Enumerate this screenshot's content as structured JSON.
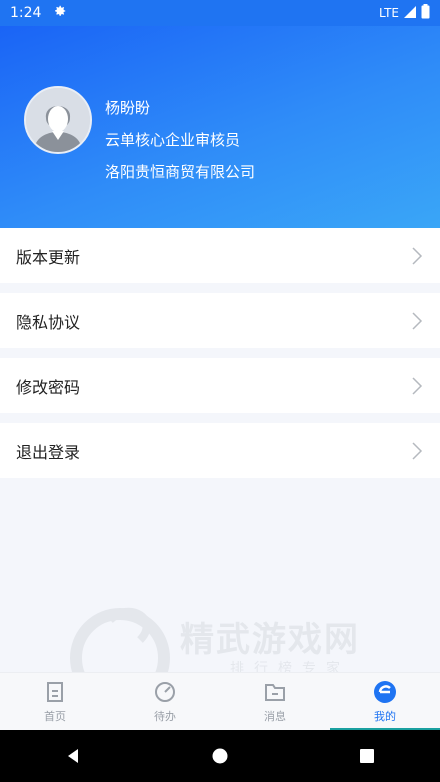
{
  "status_bar": {
    "time": "1:24",
    "network": "LTE"
  },
  "profile": {
    "name": "杨盼盼",
    "role": "云单核心企业审核员",
    "company": "洛阳贵恒商贸有限公司"
  },
  "menu": [
    {
      "label": "版本更新"
    },
    {
      "label": "隐私协议"
    },
    {
      "label": "修改密码"
    },
    {
      "label": "退出登录"
    }
  ],
  "watermark": {
    "title": "精武游戏网",
    "subtitle": "排行榜专家"
  },
  "tabs": [
    {
      "label": "首页"
    },
    {
      "label": "待办"
    },
    {
      "label": "消息"
    },
    {
      "label": "我的",
      "active": true
    }
  ],
  "colors": {
    "brand": "#1f74f2",
    "header_start": "#1a64f6",
    "header_end": "#3aa6f7",
    "tab_indicator": "#1aa0a0"
  }
}
